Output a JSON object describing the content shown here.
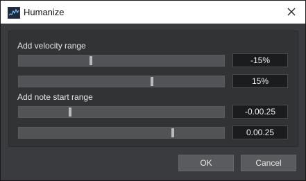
{
  "window": {
    "title": "Humanize",
    "icon": "humanize-waveform-icon",
    "close_icon": "close-icon"
  },
  "velocity": {
    "label": "Add velocity range",
    "min": {
      "value": "-15%",
      "slider_fraction": 0.35
    },
    "max": {
      "value": "15%",
      "slider_fraction": 0.65
    }
  },
  "note_start": {
    "label": "Add note start range",
    "min": {
      "value": "-0.00.25",
      "slider_fraction": 0.25
    },
    "max": {
      "value": "0.00.25",
      "slider_fraction": 0.75
    }
  },
  "buttons": {
    "ok": "OK",
    "cancel": "Cancel"
  },
  "colors": {
    "background": "#3a3b3e",
    "panel": "#323335",
    "slider_track": "#525356",
    "slider_thumb": "#b9babc",
    "value_box": "#1b1c1e",
    "button": "#5a5b5e"
  }
}
